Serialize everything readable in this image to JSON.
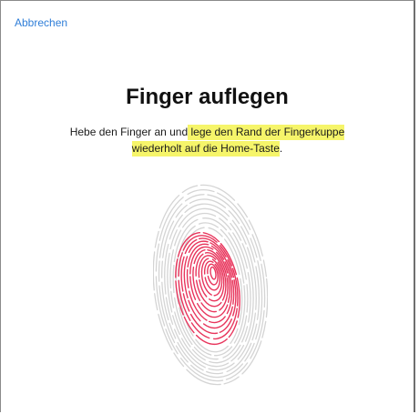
{
  "header": {
    "cancel_label": "Abbrechen"
  },
  "main": {
    "title": "Finger auflegen",
    "instruction_part1": "Hebe den Finger an und",
    "instruction_highlight_line1": " lege den Rand der Fingerkuppe",
    "instruction_highlight_line2": "wiederholt auf die Home-Taste",
    "instruction_end": "."
  },
  "fingerprint": {
    "icon": "fingerprint-icon",
    "progress": 0.5
  },
  "colors": {
    "accent": "#2f7ed8",
    "highlight": "#f6f56a",
    "ridge_done": "#e8355c",
    "ridge_pending": "#d4d4d4"
  }
}
